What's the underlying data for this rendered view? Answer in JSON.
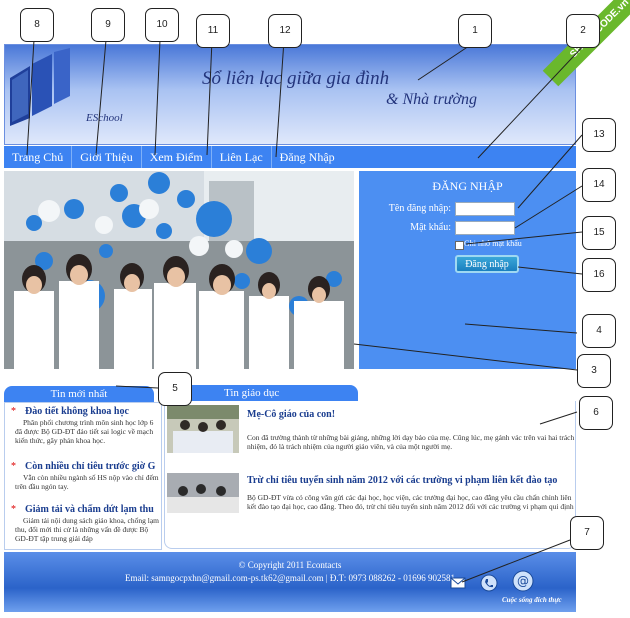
{
  "header": {
    "slogan_line1": "Sổ liên lạc giữa gia đình",
    "slogan_line2": "& Nhà trường",
    "brand": "ESchool"
  },
  "nav": {
    "items": [
      "Trang Chủ",
      "Giới Thiệu",
      "Xem Điểm",
      "Liên Lạc",
      "Đăng Nhập"
    ]
  },
  "login": {
    "title": "ĐĂNG NHẬP",
    "username_label": "Tên đăng nhập:",
    "password_label": "Mật khẩu:",
    "remember_label": "Ghi nhớ mật khẩu",
    "submit_label": "Đăng nhập"
  },
  "news": {
    "tab": "Tin mới nhất",
    "items": [
      {
        "title": "Đào tiết không khoa học",
        "body": "Phân phối chương trình môn sinh học lớp 6 đã được Bộ GD-ĐT đảo tiết sai logic về mạch kiến thức, gây phản khoa học."
      },
      {
        "title": "Còn nhiều chỉ tiêu trước giờ G",
        "body": "Vẫn còn nhiều ngành số HS nộp vào chỉ đếm trên đầu ngón tay."
      },
      {
        "title": "Giảm tải và chấm dứt lạm thu",
        "body": "Giảm tải nội dung sách giáo khoa, chống lạm thu, đổi mới thi cử là những vấn đề được Bộ GD-ĐT tập trung giải đáp"
      }
    ]
  },
  "education": {
    "tab": "Tin giáo dục",
    "items": [
      {
        "title": "Mẹ-Cô giáo của con!",
        "body": "Con đã trường thành từ những bài giảng, những lời dạy bảo của mẹ. Cũng lúc, mẹ gánh vác trên vai hai trách nhiệm, đó là trách nhiệm của người giáo viên, và của một người mẹ."
      },
      {
        "title": "Trừ chỉ tiêu tuyển sinh năm 2012 với các trường vi phạm liên kết đào tạo",
        "body": "Bộ GD-ĐT vừa có công văn gửi các đại học, học viện, các trường đại học, cao đẳng yêu cầu chấn chỉnh liên kết đào tạo đại học, cao đẳng. Theo đó, trừ chỉ tiêu tuyển sinh năm 2012 đối với các trường vi phạm qui định"
      }
    ]
  },
  "footer": {
    "copyright": "© Copyright 2011 Econtacts",
    "contact": "Email: samngocpxhn@gmail.com-ps.tk62@gmail.com | Đ.T: 0973 088262 - 01696 902581",
    "tagline": "Cuộc sống đích thực"
  },
  "ribbon": {
    "text": "SHARECODE.vn"
  },
  "callouts": [
    "1",
    "2",
    "3",
    "4",
    "5",
    "6",
    "7",
    "8",
    "9",
    "10",
    "11",
    "12",
    "13",
    "14",
    "15",
    "16"
  ],
  "colors": {
    "nav_blue": "#3d83f2",
    "login_blue": "#4c8ff2",
    "title_blue": "#1a3d8f",
    "bullet_red": "#dd0000"
  }
}
